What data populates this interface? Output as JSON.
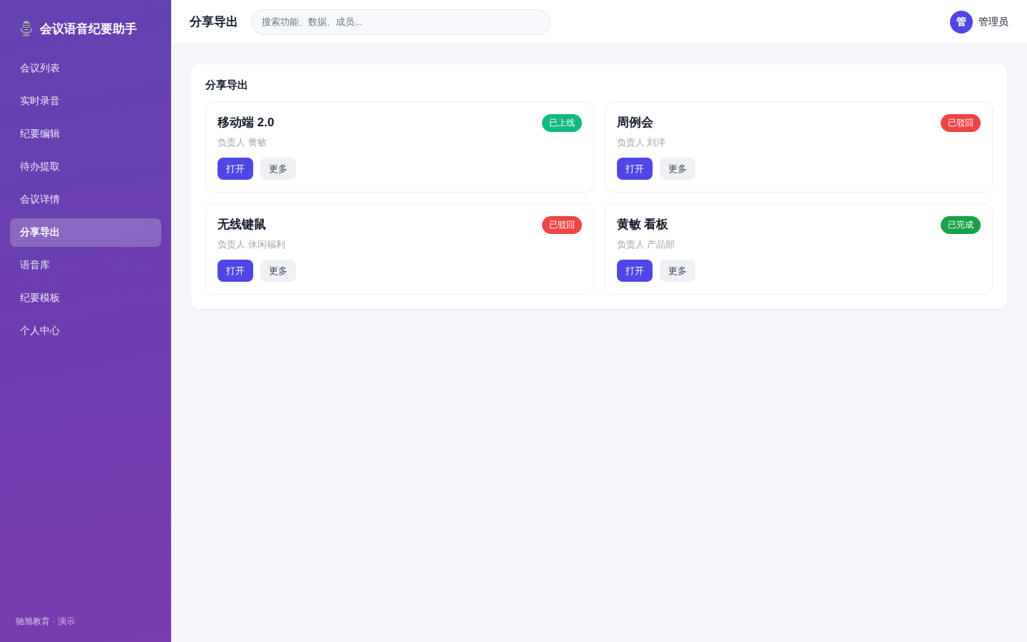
{
  "sidebar": {
    "title": "会议语音纪要助手",
    "items": [
      {
        "label": "会议列表",
        "selected": false
      },
      {
        "label": "实时录音",
        "selected": false
      },
      {
        "label": "纪要编辑",
        "selected": false
      },
      {
        "label": "待办提取",
        "selected": false
      },
      {
        "label": "会议详情",
        "selected": false
      },
      {
        "label": "分享导出",
        "selected": true
      },
      {
        "label": "语音库",
        "selected": false
      },
      {
        "label": "纪要模板",
        "selected": false
      },
      {
        "label": "个人中心",
        "selected": false
      }
    ],
    "footer": "驰旭教育 · 演示"
  },
  "header": {
    "title": "分享导出",
    "search": {
      "placeholder": "搜索功能、数据、成员..."
    },
    "user": {
      "avatar": "管",
      "name": "管理员"
    }
  },
  "panel": {
    "title": "分享导出",
    "cards": [
      {
        "title": "移动端 2.0",
        "status": {
          "label": "已上线",
          "color": "#10b981"
        },
        "owner": "负责人 黄敏",
        "buttons": [
          {
            "label": "打开",
            "kind": "primary"
          },
          {
            "label": "更多",
            "kind": "secondary"
          }
        ]
      },
      {
        "title": "周例会",
        "status": {
          "label": "已驳回",
          "color": "#ef4444"
        },
        "owner": "负责人 刘洋",
        "buttons": [
          {
            "label": "打开",
            "kind": "primary"
          },
          {
            "label": "更多",
            "kind": "secondary"
          }
        ]
      },
      {
        "title": "无线键鼠",
        "status": {
          "label": "已驳回",
          "color": "#ef4444"
        },
        "owner": "负责人 休闲福利",
        "buttons": [
          {
            "label": "打开",
            "kind": "primary"
          },
          {
            "label": "更多",
            "kind": "secondary"
          }
        ]
      },
      {
        "title": "黄敏 看板",
        "status": {
          "label": "已完成",
          "color": "#16a34a"
        },
        "owner": "负责人 产品部",
        "buttons": [
          {
            "label": "打开",
            "kind": "primary"
          },
          {
            "label": "更多",
            "kind": "secondary"
          }
        ]
      }
    ]
  }
}
